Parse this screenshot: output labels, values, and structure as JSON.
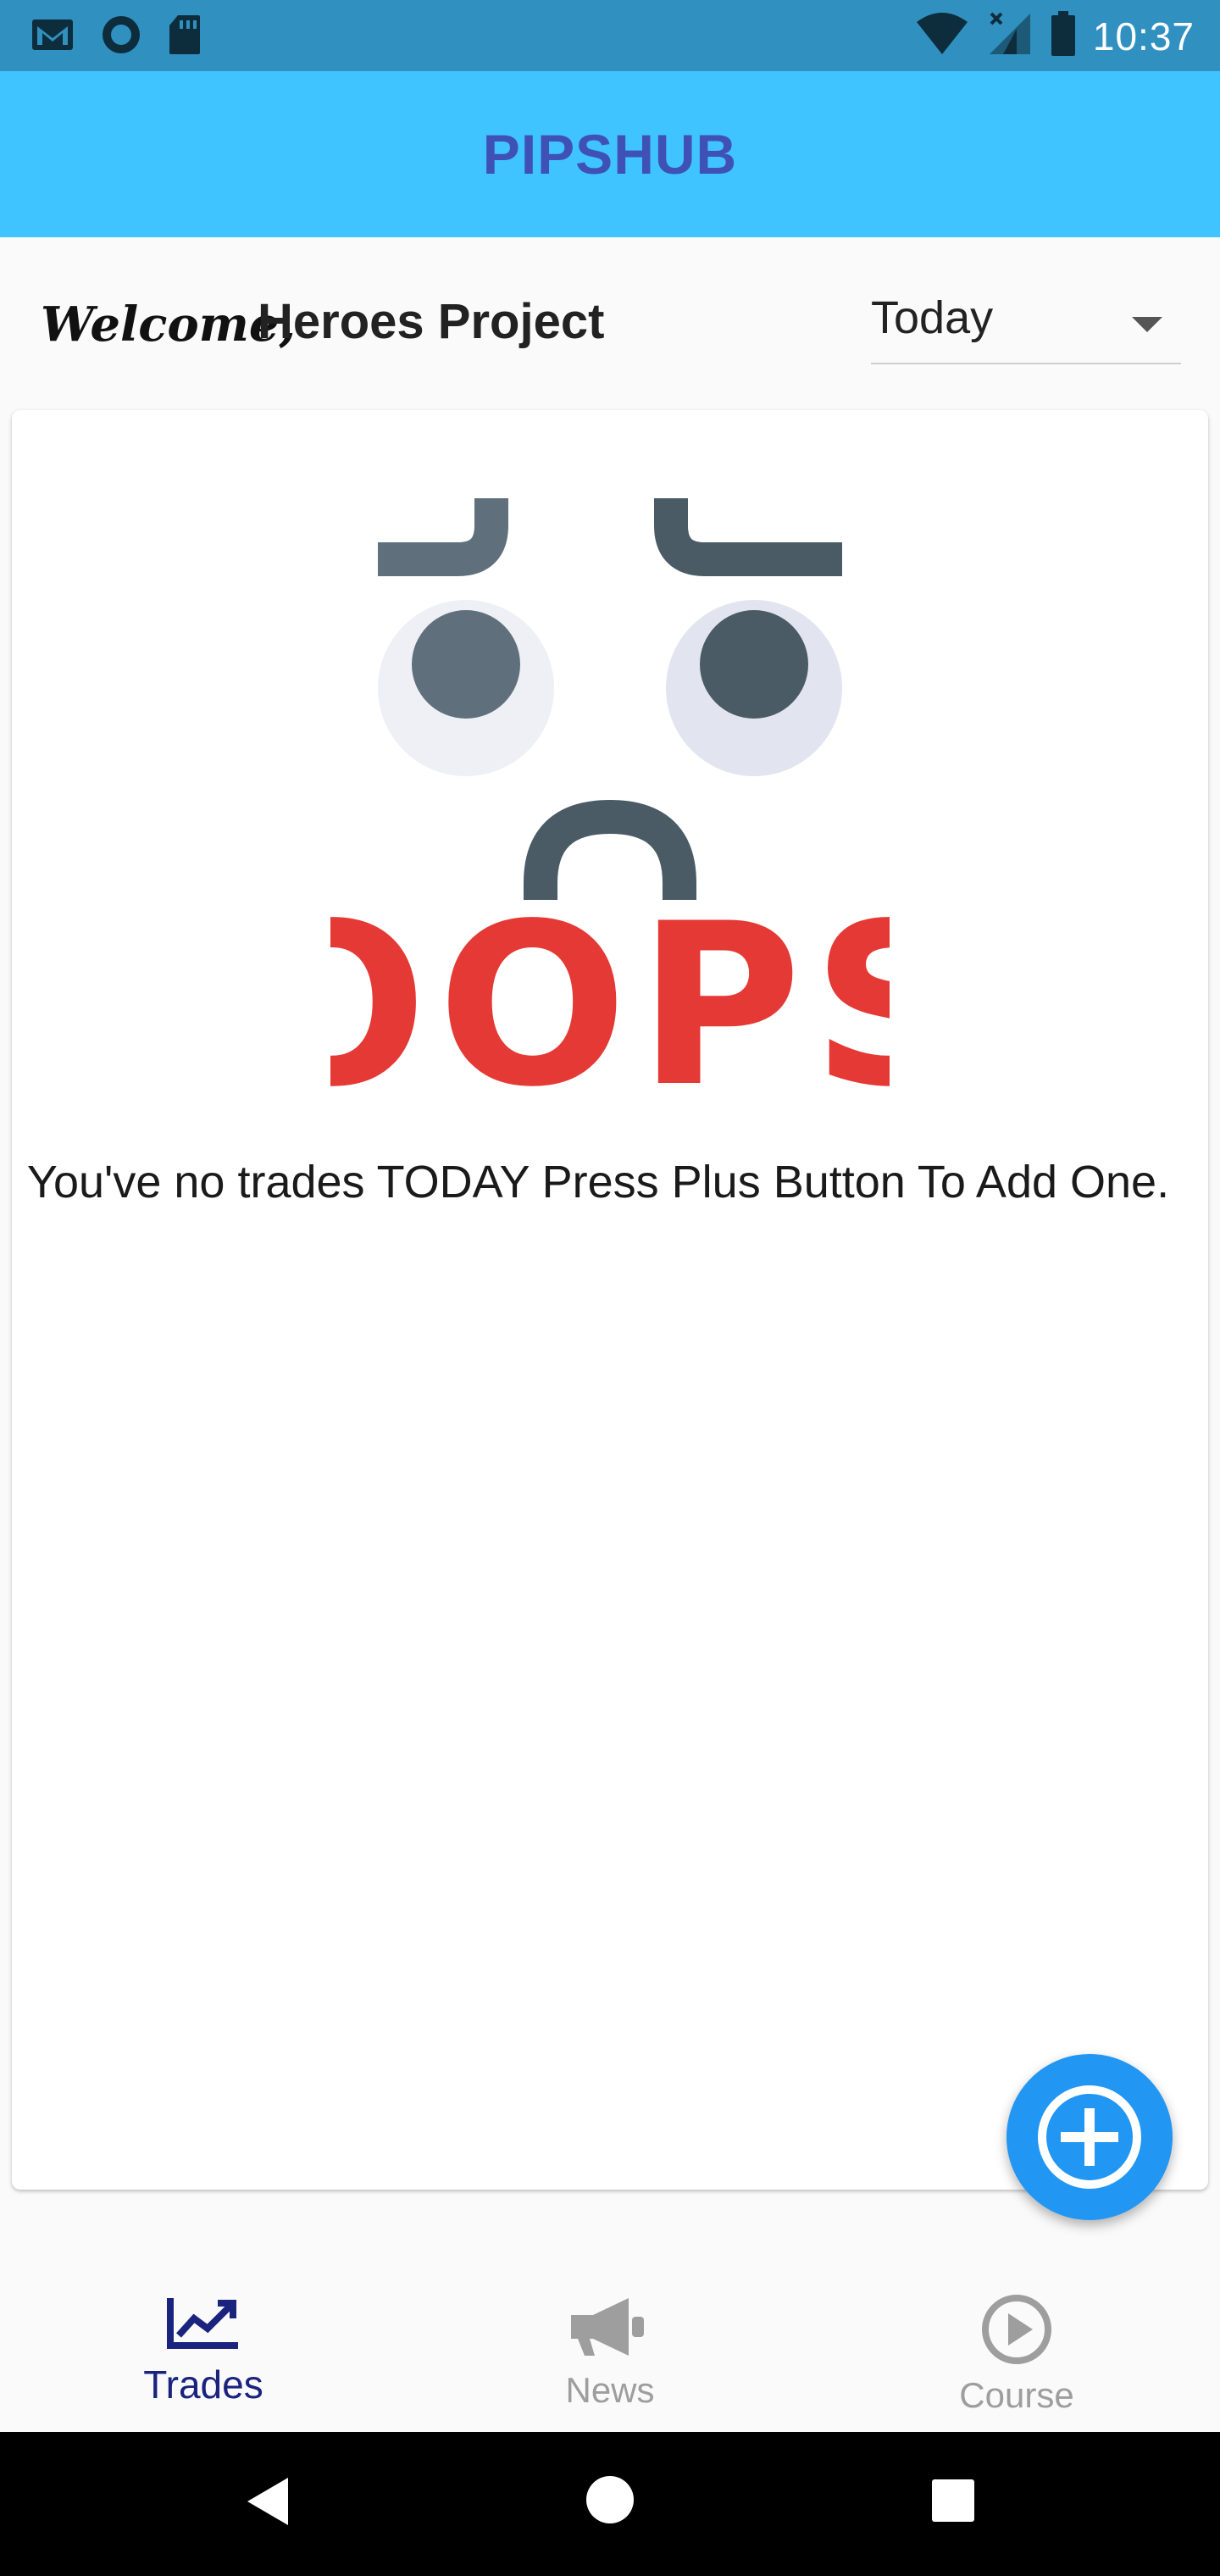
{
  "status_bar": {
    "time": "10:37",
    "left_icons": [
      "gmail-icon",
      "circle-app-icon",
      "sd-card-icon"
    ],
    "right_icons": [
      "wifi-icon",
      "cellular-signal-icon",
      "battery-icon"
    ]
  },
  "app_bar": {
    "title": "PIPSHUB"
  },
  "welcome": {
    "label": "Welcome,",
    "name": "Heroes Project"
  },
  "period_select": {
    "value": "Today"
  },
  "empty_state": {
    "illustration_text": "OOPS",
    "message": "You've no trades TODAY  Press Plus Button To Add One."
  },
  "fab": {
    "icon": "plus-circle-icon",
    "color": "#2196f3"
  },
  "bottom_nav": {
    "items": [
      {
        "label": "Trades",
        "icon": "chart-line-icon",
        "active": true
      },
      {
        "label": "News",
        "icon": "megaphone-icon",
        "active": false
      },
      {
        "label": "Course",
        "icon": "play-circle-icon",
        "active": false
      }
    ]
  },
  "colors": {
    "status_bar": "#3090c0",
    "app_bar": "#40c4ff",
    "title": "#3f51b5",
    "active_nav": "#1a237e",
    "oops_red": "#e53935"
  }
}
